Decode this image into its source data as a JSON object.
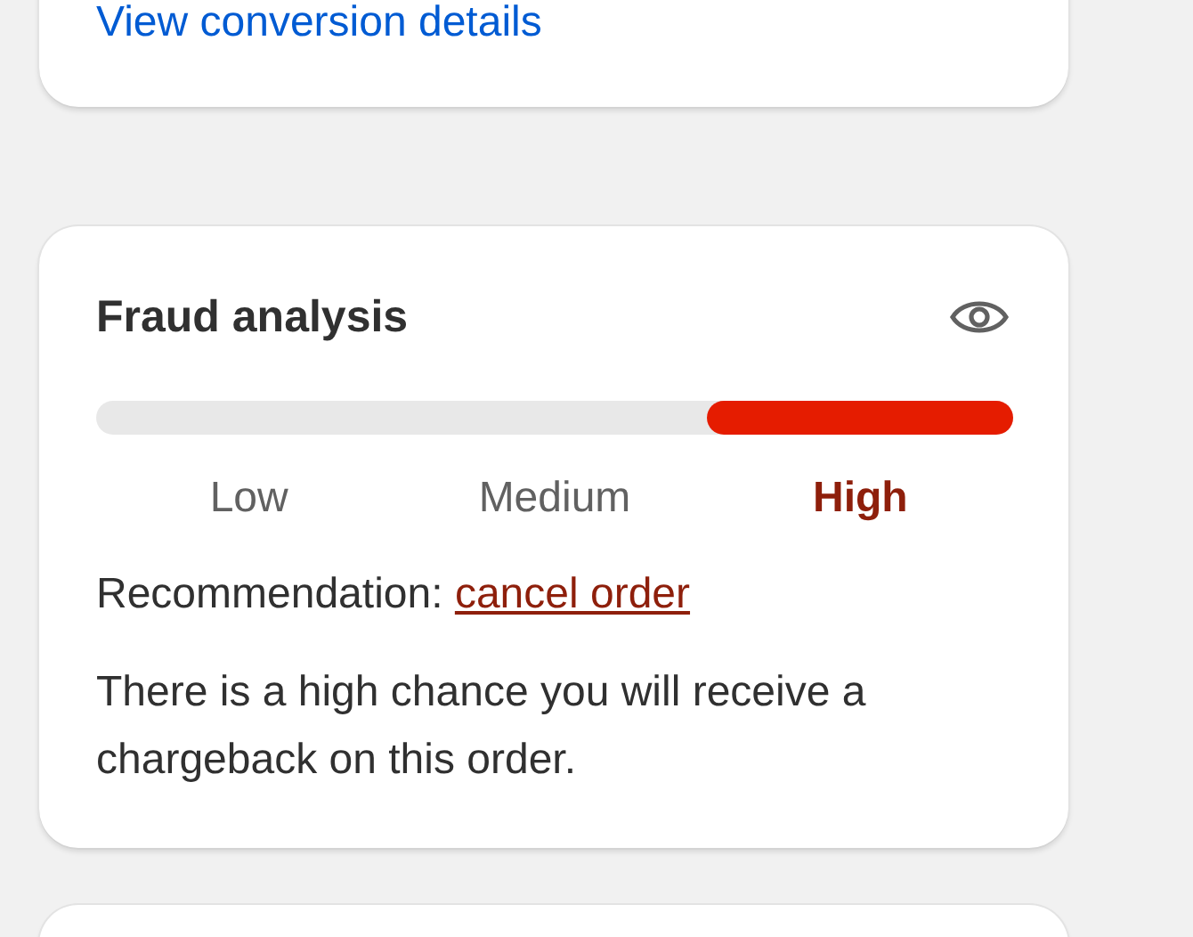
{
  "conversion_card": {
    "link": "View conversion details"
  },
  "fraud_analysis": {
    "title": "Fraud analysis",
    "risk_levels": [
      {
        "label": "Low",
        "selected": false
      },
      {
        "label": "Medium",
        "selected": false
      },
      {
        "label": "High",
        "selected": true
      }
    ],
    "recommendation_label": "Recommendation:",
    "recommendation_link": "cancel order",
    "description": "There is a high chance you will receive a chargeback on this order."
  }
}
